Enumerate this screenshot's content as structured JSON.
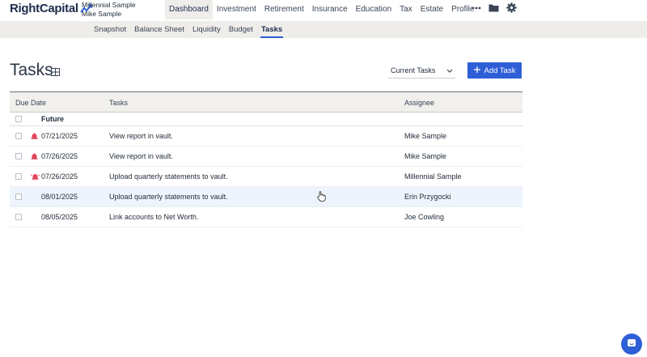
{
  "app": {
    "logo_text": "RightCapital"
  },
  "client": {
    "line1": "Millennial Sample",
    "line2": "Mike Sample"
  },
  "top_nav": [
    {
      "label": "Dashboard",
      "active": true
    },
    {
      "label": "Investment",
      "active": false
    },
    {
      "label": "Retirement",
      "active": false
    },
    {
      "label": "Insurance",
      "active": false
    },
    {
      "label": "Education",
      "active": false
    },
    {
      "label": "Tax",
      "active": false
    },
    {
      "label": "Estate",
      "active": false
    },
    {
      "label": "Profile",
      "active": false
    }
  ],
  "top_icons": {
    "more": "more-icon",
    "folder": "folder-icon",
    "settings": "gear-icon"
  },
  "sub_nav": [
    {
      "label": "Snapshot",
      "active": false
    },
    {
      "label": "Balance Sheet",
      "active": false
    },
    {
      "label": "Liquidity",
      "active": false
    },
    {
      "label": "Budget",
      "active": false
    },
    {
      "label": "Tasks",
      "active": true
    }
  ],
  "page": {
    "title": "Tasks"
  },
  "filter": {
    "selected": "Current Tasks"
  },
  "add_button": {
    "label": "Add Task"
  },
  "table": {
    "columns": {
      "due_date": "Due Date",
      "tasks": "Tasks",
      "assignee": "Assignee"
    },
    "group_label": "Future",
    "rows": [
      {
        "date": "07/21/2025",
        "task": "View report in vault.",
        "assignee": "Mike Sample",
        "alarm": true
      },
      {
        "date": "07/26/2025",
        "task": "View report in vault.",
        "assignee": "Mike Sample",
        "alarm": true
      },
      {
        "date": "07/26/2025",
        "task": "Upload quarterly statements to vault.",
        "assignee": "Millennial Sample",
        "alarm": true
      },
      {
        "date": "08/01/2025",
        "task": "Upload quarterly statements to vault.",
        "assignee": "Erin Przygocki",
        "alarm": false
      },
      {
        "date": "08/05/2025",
        "task": "Link accounts to Net Worth.",
        "assignee": "Joe Cowling",
        "alarm": false
      }
    ]
  },
  "colors": {
    "accent": "#2f5fd7",
    "subnav_bg": "#efedea",
    "alarm": "#e2455a"
  }
}
